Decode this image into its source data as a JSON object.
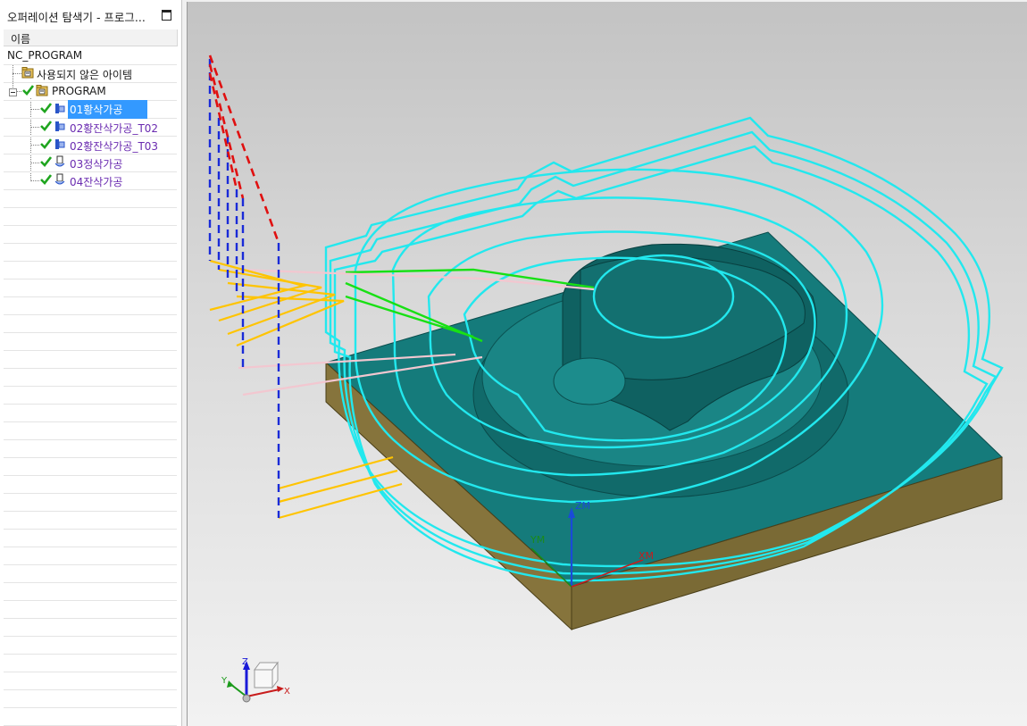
{
  "navigator": {
    "title": "오퍼레이션 탐색기 - 프로그...",
    "column_header": "이름",
    "root": "NC_PROGRAM",
    "unused_items": "사용되지 않은 아이템",
    "program": "PROGRAM",
    "operations": [
      {
        "label": "01황삭가공",
        "selected": true
      },
      {
        "label": "02황잔삭가공_T02",
        "selected": false
      },
      {
        "label": "02황잔삭가공_T03",
        "selected": false
      },
      {
        "label": "03정삭가공",
        "selected": false
      },
      {
        "label": "04잔삭가공",
        "selected": false
      }
    ]
  },
  "viewport": {
    "mcs_labels": {
      "zm": "ZM",
      "ym": "YM",
      "xm": "XM"
    },
    "triad_labels": {
      "x": "X",
      "y": "Y",
      "z": "Z"
    },
    "colors": {
      "part": "#157b7b",
      "stock_side": "#7a6a35",
      "toolpath_cut": "#22e8ee",
      "rapid": "#1a2bd8",
      "engage": "#ffc400",
      "retract": "#f2c7d0",
      "approach": "#18e014",
      "selection": "#3399ff"
    }
  }
}
